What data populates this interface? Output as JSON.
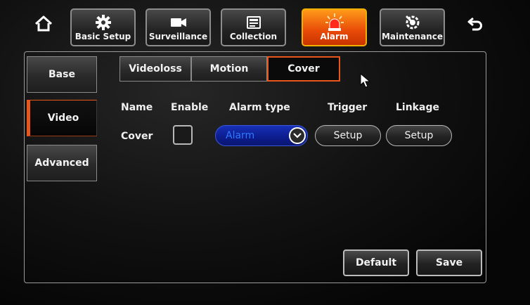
{
  "colors": {
    "accent_orange": "#e8561c",
    "active_tab_gold": "#f2b000",
    "dropdown_blue": "#0c1c8c",
    "dropdown_text_blue": "#2f78ff"
  },
  "top_bar": {
    "home_icon": "home-icon",
    "back_icon": "back-arrow-icon",
    "tabs": [
      {
        "label": "Basic Setup",
        "icon": "gear-icon",
        "active": false
      },
      {
        "label": "Surveillance",
        "icon": "camera-icon",
        "active": false
      },
      {
        "label": "Collection",
        "icon": "collection-icon",
        "active": false
      },
      {
        "label": "Alarm",
        "icon": "siren-icon",
        "active": true
      },
      {
        "label": "Maintenance",
        "icon": "wrench-gear-icon",
        "active": false
      }
    ]
  },
  "sidebar": {
    "items": [
      {
        "label": "Base",
        "active": false
      },
      {
        "label": "Video",
        "active": true
      },
      {
        "label": "Advanced",
        "active": false
      }
    ]
  },
  "sub_tabs": [
    {
      "label": "Videoloss",
      "active": false
    },
    {
      "label": "Motion",
      "active": false
    },
    {
      "label": "Cover",
      "active": true
    }
  ],
  "table": {
    "headers": {
      "name": "Name",
      "enable": "Enable",
      "alarm_type": "Alarm type",
      "trigger": "Trigger",
      "linkage": "Linkage"
    },
    "rows": [
      {
        "name": "Cover",
        "enabled": false,
        "alarm_type": "Alarm",
        "trigger_button": "Setup",
        "linkage_button": "Setup"
      }
    ]
  },
  "footer": {
    "default_label": "Default",
    "save_label": "Save"
  }
}
